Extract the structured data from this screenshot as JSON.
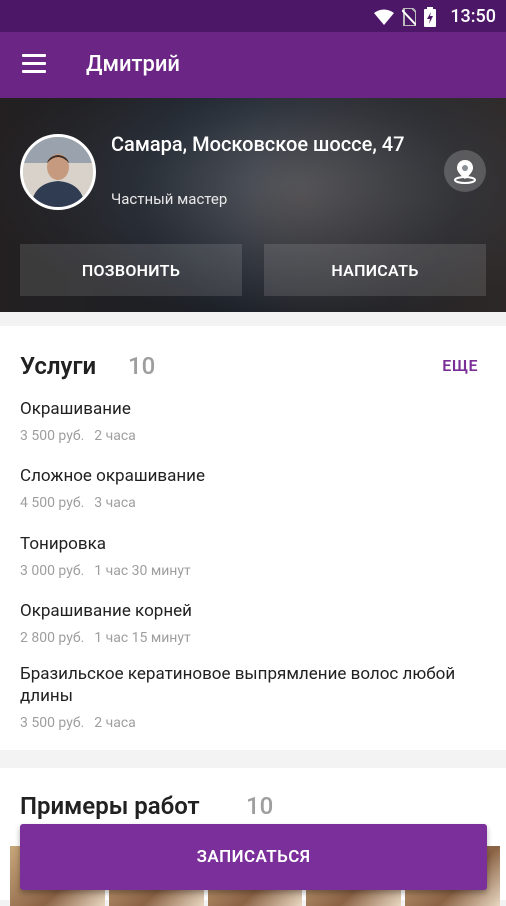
{
  "status": {
    "time": "13:50",
    "icons": [
      "wifi-icon",
      "no-sim-icon",
      "battery-icon"
    ]
  },
  "appbar": {
    "title": "Дмитрий",
    "menu_icon": "menu-icon"
  },
  "profile": {
    "address": "Самара, Московское шоссе, 47",
    "role": "Частный мастер",
    "call_label": "ПОЗВОНИТЬ",
    "write_label": "НАПИСАТЬ",
    "map_icon": "map-pin-icon"
  },
  "services": {
    "title": "Услуги",
    "count": "10",
    "more_label": "ЕЩЕ",
    "items": [
      {
        "name": "Окрашивание",
        "price": "3 500 руб.",
        "duration": "2 часа"
      },
      {
        "name": "Сложное окрашивание",
        "price": "4 500 руб.",
        "duration": "3 часа"
      },
      {
        "name": "Тонировка",
        "price": "3 000 руб.",
        "duration": "1 час 30 минут"
      },
      {
        "name": "Окрашивание корней",
        "price": "2 800 руб.",
        "duration": "1 час 15 минут"
      },
      {
        "name": "Бразильское кератиновое выпрямление волос любой длины",
        "price": "3 500 руб.",
        "duration": "2 часа"
      }
    ]
  },
  "works": {
    "title": "Примеры работ",
    "count": "10"
  },
  "book_label": "ЗАПИСАТЬСЯ",
  "colors": {
    "primary_dark": "#4b1766",
    "primary": "#6a2585",
    "accent": "#7b2f9a"
  }
}
